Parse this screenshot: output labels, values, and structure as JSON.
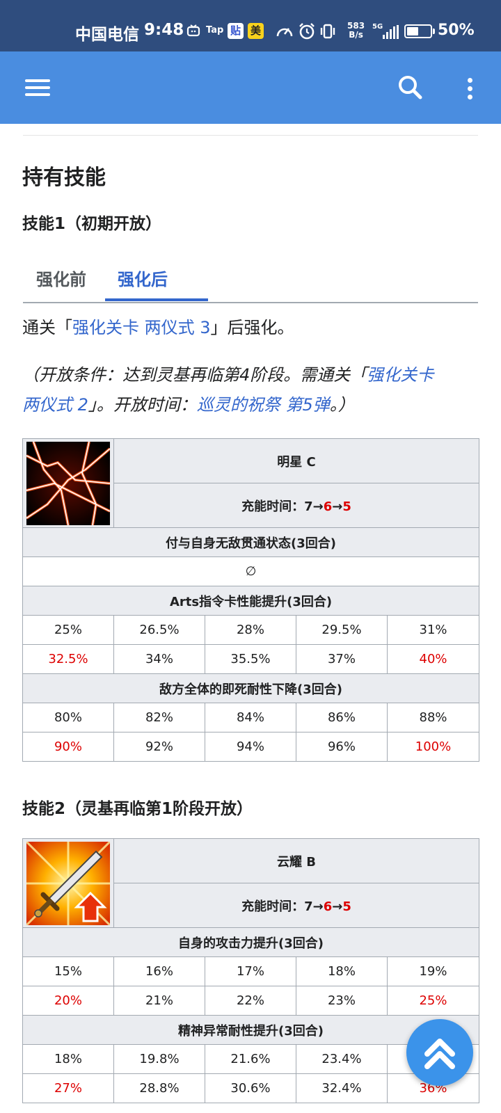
{
  "status_bar": {
    "carrier": "中国电信",
    "time": "9:48",
    "tap_label": "Tap",
    "tie_label": "贴",
    "mei_label": "美",
    "net_speed_value": "583",
    "net_speed_unit": "B/s",
    "network_type": "5G",
    "battery_percent": "50%",
    "battery_level": 0.5
  },
  "appbar": {
    "icons": [
      "menu-icon",
      "search-icon",
      "more-vert-icon"
    ]
  },
  "section": {
    "title": "持有技能"
  },
  "skill1": {
    "heading": "技能1（初期开放）",
    "tabs": {
      "before": "强化前",
      "after": "强化后"
    },
    "unlock_text": {
      "prefix": "通关「",
      "link": "强化关卡 两仪式 3",
      "suffix": "」后强化。"
    },
    "condition": {
      "prefix": "（开放条件：达到灵基再临第4阶段。需通关「",
      "link1_part1": "强化关卡",
      "link1_part2": "两仪式 2",
      "middle": "」。开放时间：",
      "link2": "巡灵的祝祭 第5弹",
      "suffix": "。）"
    },
    "name": "明星 C",
    "cooldown_prefix": "充能时间：7→",
    "cooldown_mid": "6",
    "cooldown_arrow": "→",
    "cooldown_end": "5",
    "effects": [
      {
        "title": "付与自身无敌贯通状态(3回合)",
        "value": "∅"
      },
      {
        "title": "Arts指令卡性能提升(3回合)",
        "row1": [
          "25%",
          "26.5%",
          "28%",
          "29.5%",
          "31%"
        ],
        "row2": [
          "32.5%",
          "34%",
          "35.5%",
          "37%",
          "40%"
        ]
      },
      {
        "title": "敌方全体的即死耐性下降(3回合)",
        "row1": [
          "80%",
          "82%",
          "84%",
          "86%",
          "88%"
        ],
        "row2": [
          "90%",
          "92%",
          "94%",
          "96%",
          "100%"
        ]
      }
    ]
  },
  "skill2": {
    "heading": "技能2（灵基再临第1阶段开放）",
    "name": "云耀 B",
    "cooldown_prefix": "充能时间：7→",
    "cooldown_mid": "6",
    "cooldown_arrow": "→",
    "cooldown_end": "5",
    "effects": [
      {
        "title": "自身的攻击力提升(3回合)",
        "row1": [
          "15%",
          "16%",
          "17%",
          "18%",
          "19%"
        ],
        "row2": [
          "20%",
          "21%",
          "22%",
          "23%",
          "25%"
        ]
      },
      {
        "title": "精神异常耐性提升(3回合)",
        "row1": [
          "18%",
          "19.8%",
          "21.6%",
          "23.4%",
          ""
        ],
        "row2": [
          "27%",
          "28.8%",
          "30.6%",
          "32.4%",
          "36%"
        ]
      }
    ]
  },
  "colors": {
    "status_bar": "#2f4d7e",
    "app_bar": "#4a8de0",
    "link": "#3366cc",
    "highlight_red": "#dd0000",
    "table_header": "#eaecf0",
    "fab": "#3b93ea"
  },
  "fab": {
    "icon": "double-chevron-up-icon"
  }
}
